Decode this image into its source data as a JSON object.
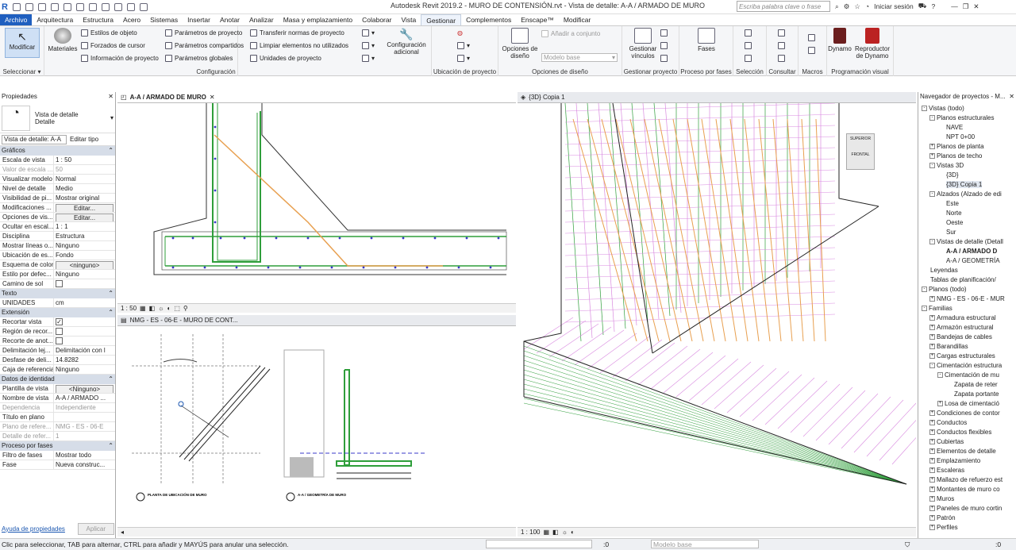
{
  "title": "Autodesk Revit 2019.2 - MURO DE CONTENSIÓN.rvt - Vista de detalle: A-A / ARMADO DE MURO",
  "search_placeholder": "Escriba palabra clave o frase",
  "user_label": "Iniciar sesión",
  "tabs": [
    "Archivo",
    "Arquitectura",
    "Estructura",
    "Acero",
    "Sistemas",
    "Insertar",
    "Anotar",
    "Analizar",
    "Masa y emplazamiento",
    "Colaborar",
    "Vista",
    "Gestionar",
    "Complementos",
    "Enscape™",
    "Modificar"
  ],
  "ribbon": {
    "modificar": "Modificar",
    "materiales": "Materiales",
    "seleccionar": "Seleccionar ▾",
    "config_items": [
      "Estilos de objeto",
      "Forzados de cursor",
      "Información de proyecto",
      "Parámetros de proyecto",
      "Parámetros compartidos",
      "Parámetros globales",
      "Transferir normas de proyecto",
      "Limpiar elementos no utilizados",
      "Unidades de proyecto"
    ],
    "configuracion_adicional": "Configuración adicional",
    "configuracion_label": "Configuración",
    "ubicacion_label": "Ubicación de proyecto",
    "opciones_diseno": "Opciones de diseño",
    "anadir_conjunto": "Añadir a conjunto",
    "modelo_base": "Modelo base",
    "opciones_diseno_label": "Opciones de diseño",
    "gestionar_vinculos": "Gestionar vínculos",
    "gestionar_proyecto_label": "Gestionar proyecto",
    "fases": "Fases",
    "proceso_fases_label": "Proceso por fases",
    "seleccion_label": "Selección",
    "consultar_label": "Consultar",
    "macros_label": "Macros",
    "dynamo": "Dynamo",
    "reproductor": "Reproductor de Dynamo",
    "programacion_label": "Programación visual"
  },
  "properties": {
    "title": "Propiedades",
    "type_line1": "Vista de detalle",
    "type_line2": "Detalle",
    "selector": "Vista de detalle: A-A",
    "edit_type": "Editar tipo",
    "groups": [
      {
        "name": "Gráficos",
        "rows": [
          [
            "Escala de vista",
            "1 : 50",
            0
          ],
          [
            "Valor de escala ...",
            "50",
            1
          ],
          [
            "Visualizar modelo",
            "Normal",
            0
          ],
          [
            "Nivel de detalle",
            "Medio",
            0
          ],
          [
            "Visibilidad de pi...",
            "Mostrar original",
            0
          ],
          [
            "Modificaciones ...",
            "Editar...",
            0
          ],
          [
            "Opciones de vis...",
            "Editar...",
            0
          ],
          [
            "Ocultar en escal...",
            "1 : 1",
            0
          ],
          [
            "Disciplina",
            "Estructura",
            0
          ],
          [
            "Mostrar líneas o...",
            "Ninguno",
            0
          ],
          [
            "Ubicación de es...",
            "Fondo",
            0
          ],
          [
            "Esquema de color",
            "<ninguno>",
            0
          ],
          [
            "Estilo por defec...",
            "Ninguno",
            0
          ],
          [
            "Camino de sol",
            "",
            0
          ]
        ]
      },
      {
        "name": "Texto",
        "rows": [
          [
            "UNIDADES",
            "cm",
            0
          ]
        ]
      },
      {
        "name": "Extensión",
        "rows": [
          [
            "Recortar vista",
            "✓",
            0
          ],
          [
            "Región de recor...",
            "",
            0
          ],
          [
            "Recorte de anot...",
            "",
            0
          ],
          [
            "Delimitación lej...",
            "Delimitación con l",
            0
          ],
          [
            "Desfase de deli...",
            "14.8282",
            0
          ],
          [
            "Caja de referencia",
            "Ninguno",
            0
          ]
        ]
      },
      {
        "name": "Datos de identidad",
        "rows": [
          [
            "Plantilla de vista",
            "<Ninguno>",
            0
          ],
          [
            "Nombre de vista",
            "A-A / ARMADO ...",
            0
          ],
          [
            "Dependencia",
            "Independiente",
            1
          ],
          [
            "Título en plano",
            "",
            0
          ],
          [
            "Plano de refere...",
            "NMG - ES - 06-E",
            1
          ],
          [
            "Detalle de refer...",
            "1",
            1
          ]
        ]
      },
      {
        "name": "Proceso por fases",
        "rows": [
          [
            "Filtro de fases",
            "Mostrar todo",
            0
          ],
          [
            "Fase",
            "Nueva construc...",
            0
          ]
        ]
      }
    ],
    "help_link": "Ayuda de propiedades",
    "apply": "Aplicar"
  },
  "views": {
    "tab1": "A-A / ARMADO DE MURO",
    "tab2": "NMG - ES - 06-E - MURO DE CONT...",
    "tab3": "{3D} Copia 1",
    "scale1": "1 : 50",
    "scale3": "1 : 100",
    "cube_top": "SUPERIOR",
    "cube_front": "FRONTAL",
    "sheet_label1": "PLANTA DE UBICACIÓN DE MURO",
    "sheet_label2": "A-A / GEOMETRÍA DE MURO"
  },
  "browser": {
    "title": "Navegador de proyectos - M...",
    "nodes": [
      [
        0,
        "-",
        "Vistas (todo)"
      ],
      [
        1,
        "-",
        "Planos estructurales"
      ],
      [
        2,
        "",
        "NAVE"
      ],
      [
        2,
        "",
        "NPT 0+00"
      ],
      [
        1,
        "+",
        "Planos de planta"
      ],
      [
        1,
        "+",
        "Planos de techo"
      ],
      [
        1,
        "-",
        "Vistas 3D"
      ],
      [
        2,
        "",
        "{3D}"
      ],
      [
        2,
        "",
        "{3D} Copia 1"
      ],
      [
        1,
        "-",
        "Alzados (Alzado de edi"
      ],
      [
        2,
        "",
        "Este"
      ],
      [
        2,
        "",
        "Norte"
      ],
      [
        2,
        "",
        "Oeste"
      ],
      [
        2,
        "",
        "Sur"
      ],
      [
        1,
        "-",
        "Vistas de detalle (Detall"
      ],
      [
        2,
        "",
        "A-A / ARMADO D"
      ],
      [
        2,
        "",
        "A-A / GEOMETRÍA"
      ],
      [
        0,
        "",
        "Leyendas"
      ],
      [
        0,
        "",
        "Tablas de planificación/"
      ],
      [
        0,
        "-",
        "Planos (todo)"
      ],
      [
        1,
        "+",
        "NMG - ES - 06-E - MUR"
      ],
      [
        0,
        "-",
        "Familias"
      ],
      [
        1,
        "+",
        "Armadura estructural"
      ],
      [
        1,
        "+",
        "Armazón estructural"
      ],
      [
        1,
        "+",
        "Bandejas de cables"
      ],
      [
        1,
        "+",
        "Barandillas"
      ],
      [
        1,
        "+",
        "Cargas estructurales"
      ],
      [
        1,
        "-",
        "Cimentación estructura"
      ],
      [
        2,
        "-",
        "Cimentación de mu"
      ],
      [
        3,
        "",
        "Zapata de reter"
      ],
      [
        3,
        "",
        "Zapata portante"
      ],
      [
        2,
        "+",
        "Losa de cimentació"
      ],
      [
        1,
        "+",
        "Condiciones de contor"
      ],
      [
        1,
        "+",
        "Conductos"
      ],
      [
        1,
        "+",
        "Conductos flexibles"
      ],
      [
        1,
        "+",
        "Cubiertas"
      ],
      [
        1,
        "+",
        "Elementos de detalle"
      ],
      [
        1,
        "+",
        "Emplazamiento"
      ],
      [
        1,
        "+",
        "Escaleras"
      ],
      [
        1,
        "+",
        "Mallazo de refuerzo est"
      ],
      [
        1,
        "+",
        "Montantes de muro co"
      ],
      [
        1,
        "+",
        "Muros"
      ],
      [
        1,
        "+",
        "Paneles de muro cortin"
      ],
      [
        1,
        "+",
        "Patrón"
      ],
      [
        1,
        "+",
        "Perfiles"
      ]
    ]
  },
  "status": {
    "hint": "Clic para seleccionar, TAB para alternar, CTRL para añadir y MAYÚS para anular una selección.",
    "count": ":0",
    "model": "Modelo base"
  },
  "colors": {
    "file_tab": "#1f5fbf",
    "group_bg": "#d6dde8",
    "rebar_green": "#2e9e3a",
    "rebar_orange": "#e8a050",
    "rebar_pink": "#d98ae0"
  }
}
